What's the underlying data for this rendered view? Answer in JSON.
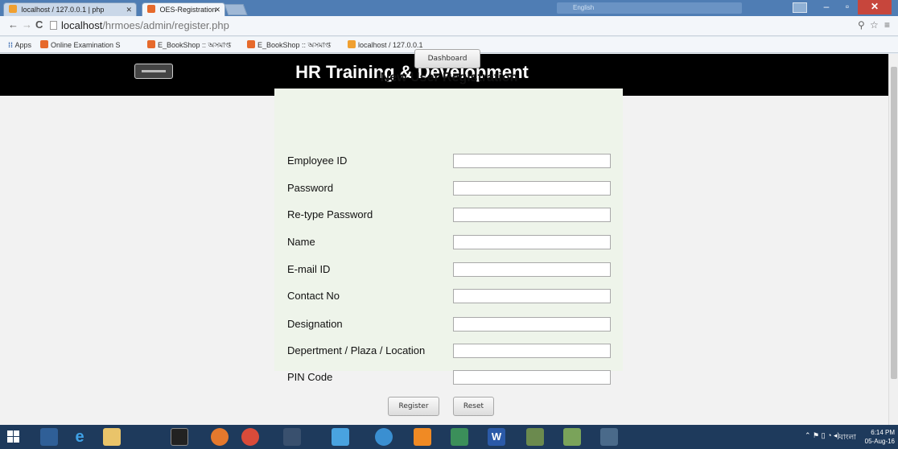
{
  "browser": {
    "tabs": [
      {
        "title": "localhost / 127.0.0.1 | php",
        "active": false
      },
      {
        "title": "OES-Registration",
        "active": true
      }
    ],
    "url_host": "localhost",
    "url_path": "/hrmoes/admin/register.php",
    "bookmarks": [
      "Apps",
      "Online Examination S",
      "E_BookShop :: অসমাপ্ত",
      "E_BookShop :: অসমাপ্ত",
      "localhost / 127.0.0.1"
    ],
    "ime_label": "English"
  },
  "header": {
    "title": "HR Training & Development"
  },
  "nav": {
    "dashboard_label": "Dashboard"
  },
  "form": {
    "title": "New User Registration",
    "fields": [
      {
        "label": "Employee ID",
        "value": ""
      },
      {
        "label": "Password",
        "value": ""
      },
      {
        "label": "Re-type Password",
        "value": ""
      },
      {
        "label": "Name",
        "value": ""
      },
      {
        "label": "E-mail ID",
        "value": ""
      },
      {
        "label": "Contact No",
        "value": ""
      },
      {
        "label": "Designation",
        "value": ""
      },
      {
        "label": "Depertment / Plaza / Location",
        "value": ""
      },
      {
        "label": "PIN Code",
        "value": ""
      }
    ],
    "register_label": "Register",
    "reset_label": "Reset"
  },
  "taskbar": {
    "lang": "বাংলা",
    "time": "6:14 PM",
    "date": "05-Aug-16"
  },
  "colors": {
    "header_bg": "#000000",
    "panel_bg": "#eef4ea",
    "close_button": "#c7463c"
  }
}
